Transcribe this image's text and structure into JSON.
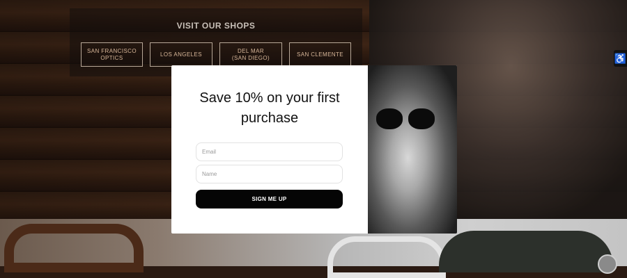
{
  "shops": {
    "title": "VISIT OUR SHOPS",
    "items": [
      {
        "label": "SAN FRANCISCO\nOPTICS"
      },
      {
        "label": "LOS ANGELES"
      },
      {
        "label": "DEL MAR\n(SAN DIEGO)"
      },
      {
        "label": "SAN CLEMENTE"
      }
    ]
  },
  "popup": {
    "title": "Save 10% on your first purchase",
    "email_placeholder": "Email",
    "name_placeholder": "Name",
    "button_label": "SIGN ME UP"
  },
  "icons": {
    "accessibility": "accessibility-icon"
  }
}
